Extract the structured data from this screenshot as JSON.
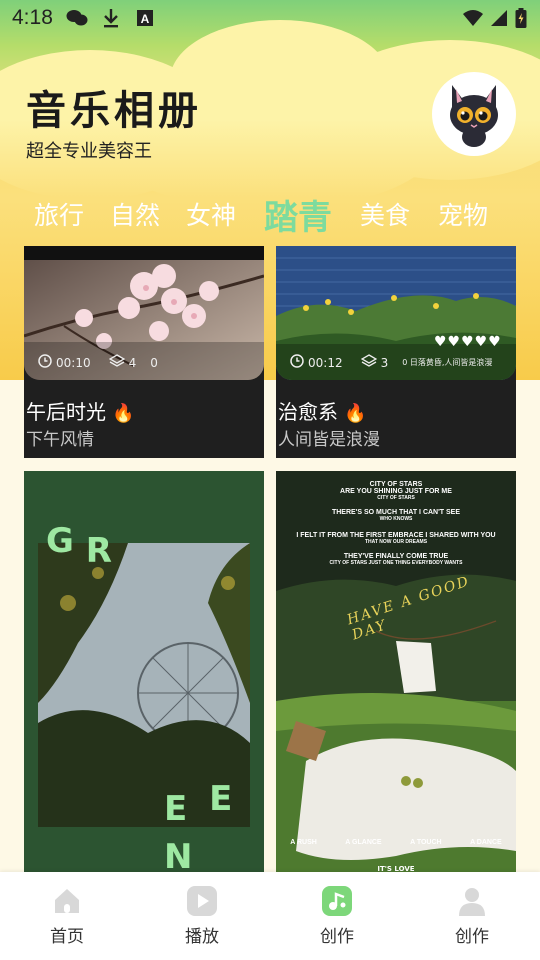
{
  "status": {
    "time": "4:18"
  },
  "header": {
    "title": "音乐相册",
    "subtitle": "超全专业美容王"
  },
  "tabs": [
    {
      "label": "旅行",
      "active": false
    },
    {
      "label": "自然",
      "active": false
    },
    {
      "label": "女神",
      "active": false
    },
    {
      "label": "踏青",
      "active": true
    },
    {
      "label": "美食",
      "active": false
    },
    {
      "label": "宠物",
      "active": false
    }
  ],
  "cards": [
    {
      "title": "午后时光",
      "subtitle": "下午风情",
      "duration": "00:10",
      "layers": "4",
      "count": "0"
    },
    {
      "title": "治愈系",
      "subtitle": "人间皆是浪漫",
      "duration": "00:12",
      "layers": "3",
      "count": "0",
      "overlay_text": "0 日落黄昏,人间皆是浪漫",
      "hearts": "♥♥♥♥♥"
    },
    {
      "letters_top": [
        "G",
        "R"
      ],
      "letters_bottom": [
        "E",
        "E",
        "N"
      ]
    },
    {
      "poster_lines": [
        "CITY OF STARS",
        "ARE YOU SHINING JUST FOR ME",
        "CITY OF STARS",
        "THERE'S SO MUCH THAT I CAN'T SEE",
        "WHO KNOWS",
        "I FELT IT FROM THE FIRST EMBRACE I SHARED WITH YOU",
        "THAT NOW OUR DREAMS",
        "THEY'VE FINALLY COME TRUE",
        "CITY OF STARS JUST ONE THING EVERYBODY WANTS"
      ],
      "script_text": "HAVE A GOOD DAY",
      "bottom_words": [
        "A RUSH",
        "A GLANCE",
        "A TOUCH",
        "A DANCE"
      ],
      "bottom_caption": "IT'S LOVE"
    }
  ],
  "nav": [
    {
      "label": "首页"
    },
    {
      "label": "播放"
    },
    {
      "label": "创作"
    },
    {
      "label": "创作"
    }
  ],
  "colors": {
    "active_tab": "#7DDB9E",
    "card_bg": "#1F1F1F",
    "accent_green": "#7DD77A"
  }
}
